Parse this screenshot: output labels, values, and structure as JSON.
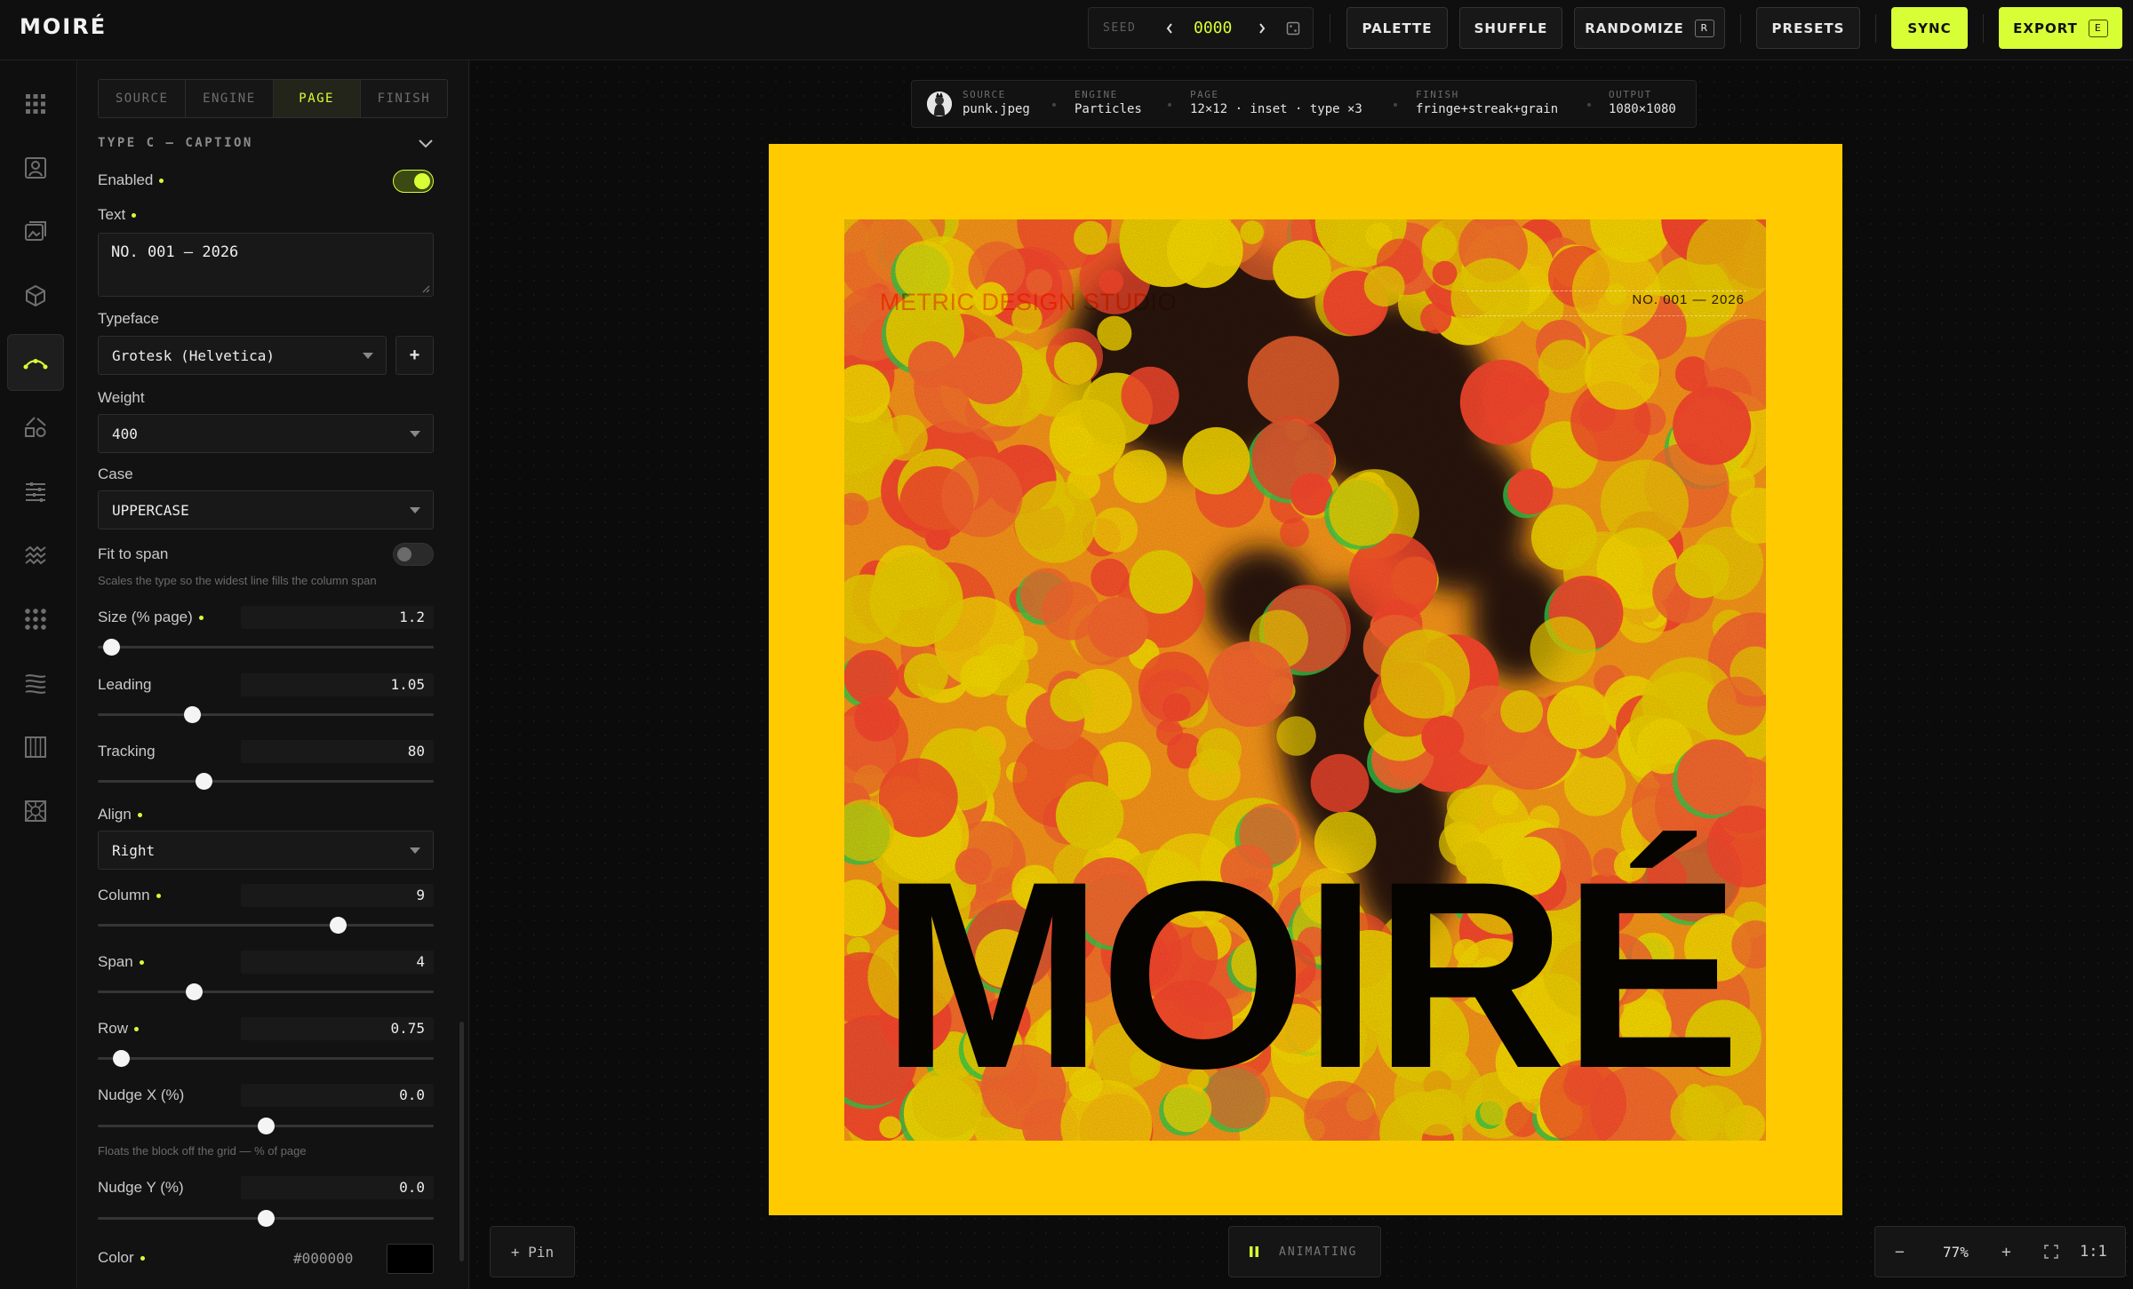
{
  "app": {
    "logo": "MOIRÉ"
  },
  "topbar": {
    "seed_label": "SEED",
    "seed_value": "0000",
    "palette_label": "PALETTE",
    "shuffle_label": "SHUFFLE",
    "randomize_label": "RANDOMIZE",
    "randomize_key": "R",
    "presets_label": "PRESETS",
    "sync_label": "SYNC",
    "export_label": "EXPORT",
    "export_key": "E"
  },
  "panel": {
    "tabs": [
      {
        "label": "SOURCE",
        "active": false
      },
      {
        "label": "ENGINE",
        "active": false
      },
      {
        "label": "PAGE",
        "active": true
      },
      {
        "label": "FINISH",
        "active": false
      }
    ],
    "section_title": "TYPE C — CAPTION",
    "enabled_label": "Enabled",
    "enabled_on": true,
    "text_label": "Text",
    "text_value": "NO. 001 — 2026",
    "typeface_label": "Typeface",
    "typeface_value": "Grotesk (Helvetica)",
    "add_label": "+",
    "weight_label": "Weight",
    "weight_value": "400",
    "case_label": "Case",
    "case_value": "UPPERCASE",
    "fit_label": "Fit to span",
    "fit_on": false,
    "fit_hint": "Scales the type so the widest line fills the column span",
    "size_label": "Size (% page)",
    "size_value": "1.2",
    "size_level": 0.04,
    "leading_label": "Leading",
    "leading_value": "1.05",
    "leading_level": 0.28,
    "tracking_label": "Tracking",
    "tracking_value": "80",
    "tracking_level": 0.315,
    "align_label": "Align",
    "align_value": "Right",
    "column_label": "Column",
    "column_value": "9",
    "column_level": 0.715,
    "span_label": "Span",
    "span_value": "4",
    "span_level": 0.285,
    "row_label": "Row",
    "row_value": "0.75",
    "row_level": 0.07,
    "nudgex_label": "Nudge X (%)",
    "nudgex_value": "0.0",
    "nudgex_level": 0.5,
    "nudgex_hint": "Floats the block off the grid — % of page",
    "nudgey_label": "Nudge Y (%)",
    "nudgey_value": "0.0",
    "nudgey_level": 0.5,
    "color_label": "Color",
    "color_value": "#000000"
  },
  "breadcrumbs": [
    {
      "key": "SOURCE",
      "value": "punk.jpeg"
    },
    {
      "key": "ENGINE",
      "value": "Particles"
    },
    {
      "key": "PAGE",
      "value": "12×12 · inset · type ×3"
    },
    {
      "key": "FINISH",
      "value": "fringe+streak+grain"
    },
    {
      "key": "OUTPUT",
      "value": "1080×1080"
    }
  ],
  "poster": {
    "studio_text": "METRIC DESIGN STUDIO",
    "caption_text": "NO. 001 — 2026",
    "title_text": "MOIRÉ",
    "frame_color": "#ffcb00",
    "particle_colors": [
      "#ffe000",
      "#f4d400",
      "#ff4a2e",
      "#ff6a30"
    ],
    "fringe_color": "#33d14a"
  },
  "bottom": {
    "pin_label": "+ Pin",
    "status_label": "ANIMATING",
    "zoom_minus": "−",
    "zoom_value": "77%",
    "zoom_plus": "+",
    "zoom_reset": "1:1"
  },
  "colors": {
    "accent": "#d8ff36",
    "bg": "#0d0d0d"
  }
}
